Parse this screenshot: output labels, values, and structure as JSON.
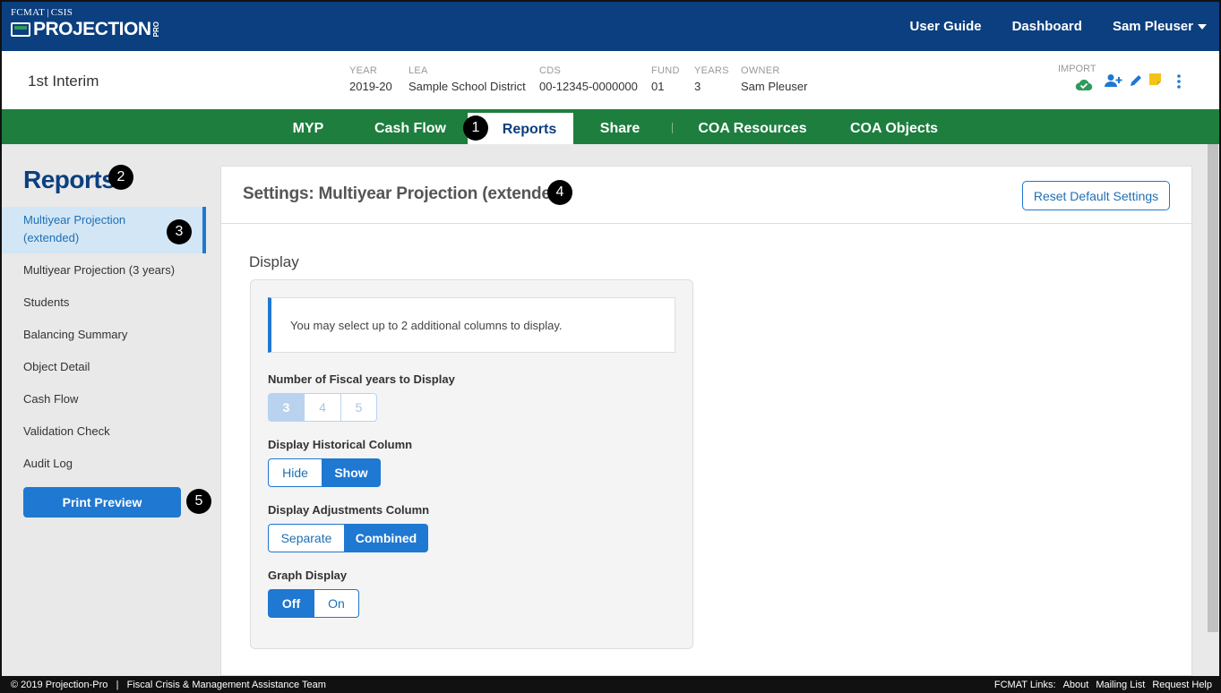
{
  "app": {
    "org_left": "FCMAT",
    "org_right": "CSIS",
    "brand": "PROJECTION",
    "brand_suffix": "PRO"
  },
  "topnav": {
    "user_guide": "User Guide",
    "dashboard": "Dashboard",
    "user": "Sam Pleuser"
  },
  "infobar": {
    "title": "1st Interim",
    "fields": [
      {
        "label": "YEAR",
        "value": "2019-20"
      },
      {
        "label": "LEA",
        "value": "Sample School District"
      },
      {
        "label": "CDS",
        "value": "00-12345-0000000"
      },
      {
        "label": "FUND",
        "value": "01"
      },
      {
        "label": "YEARS",
        "value": "3"
      },
      {
        "label": "OWNER",
        "value": "Sam Pleuser"
      }
    ],
    "import_label": "IMPORT"
  },
  "tabs": [
    {
      "label": "MYP",
      "active": false
    },
    {
      "label": "Cash Flow",
      "active": false
    },
    {
      "label": "Reports",
      "active": true
    },
    {
      "label": "Share",
      "active": false
    },
    {
      "label": "COA Resources",
      "active": false
    },
    {
      "label": "COA Objects",
      "active": false
    }
  ],
  "badges": [
    "1",
    "2",
    "3",
    "4",
    "5"
  ],
  "sidebar": {
    "title": "Reports",
    "items": [
      {
        "label": "Multiyear Projection (extended)",
        "active": true
      },
      {
        "label": "Multiyear Projection (3 years)",
        "active": false
      },
      {
        "label": "Students",
        "active": false
      },
      {
        "label": "Balancing Summary",
        "active": false
      },
      {
        "label": "Object Detail",
        "active": false
      },
      {
        "label": "Cash Flow",
        "active": false
      },
      {
        "label": "Validation Check",
        "active": false
      },
      {
        "label": "Audit Log",
        "active": false
      }
    ],
    "print_button": "Print Preview"
  },
  "panel": {
    "title": "Settings: Multiyear Projection (extended)",
    "reset_button": "Reset Default Settings",
    "section": "Display",
    "notice": "You may select up to 2 additional columns to display.",
    "groups": [
      {
        "label": "Number of Fiscal years to Display",
        "options": [
          "3",
          "4",
          "5"
        ],
        "selected": "3",
        "disabled": true
      },
      {
        "label": "Display Historical Column",
        "options": [
          "Hide",
          "Show"
        ],
        "selected": "Show",
        "disabled": false
      },
      {
        "label": "Display Adjustments Column",
        "options": [
          "Separate",
          "Combined"
        ],
        "selected": "Combined",
        "disabled": false
      },
      {
        "label": "Graph Display",
        "options": [
          "Off",
          "On"
        ],
        "selected": "Off",
        "disabled": false
      }
    ]
  },
  "footer": {
    "copyright": "© 2019 Projection-Pro",
    "divider": "|",
    "team": "Fiscal Crisis & Management Assistance Team",
    "links_label": "FCMAT Links:",
    "links": [
      "About",
      "Mailing List",
      "Request Help"
    ]
  },
  "colors": {
    "header_blue": "#0b3f7f",
    "tab_green": "#1e7e3e",
    "accent_blue": "#1f78d1",
    "badge_black": "#000000"
  }
}
